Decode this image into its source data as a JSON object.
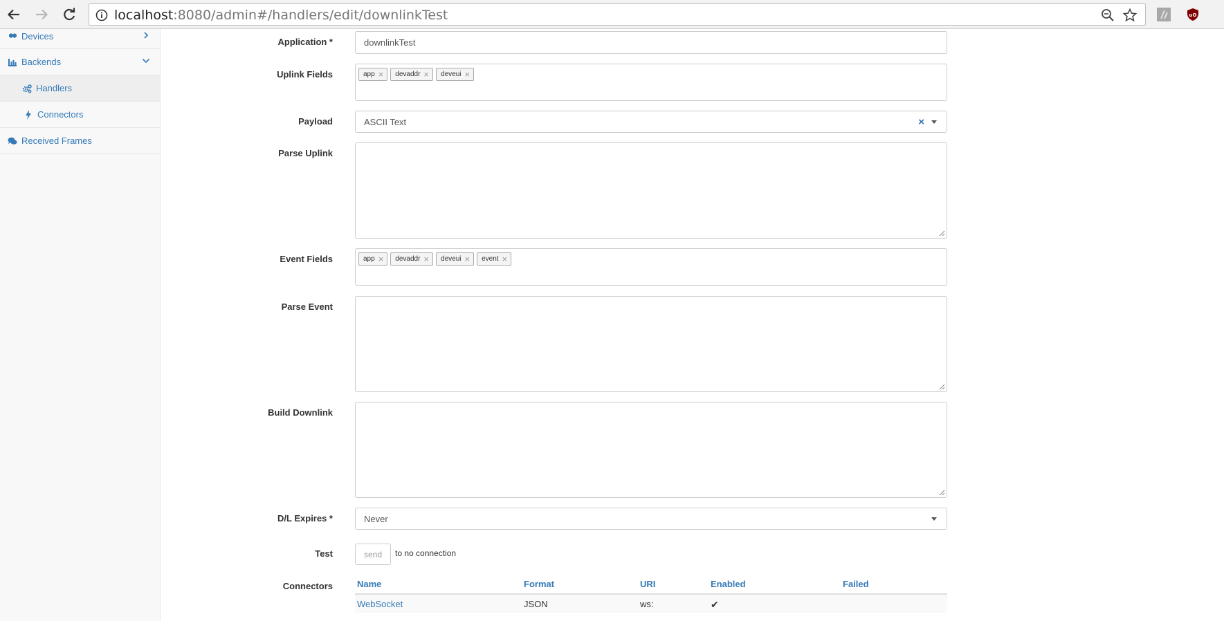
{
  "browser": {
    "url_host": "localhost",
    "url_rest": ":8080/admin#/handlers/edit/downlinkTest",
    "colors": {
      "ublock": "#800000"
    }
  },
  "sidebar": {
    "items": [
      {
        "label": "Devices",
        "icon": "cubes-icon"
      },
      {
        "label": "Backends",
        "icon": "bar-chart-icon"
      },
      {
        "label": "Handlers",
        "icon": "cogs-icon",
        "active": true
      },
      {
        "label": "Connectors",
        "icon": "bolt-icon"
      },
      {
        "label": "Received Frames",
        "icon": "comments-icon"
      }
    ]
  },
  "form": {
    "application": {
      "label": "Application *",
      "value": "downlinkTest"
    },
    "uplink_fields": {
      "label": "Uplink Fields",
      "tags": [
        "app",
        "devaddr",
        "deveui"
      ]
    },
    "payload": {
      "label": "Payload",
      "value": "ASCII Text"
    },
    "parse_uplink": {
      "label": "Parse Uplink",
      "value": ""
    },
    "event_fields": {
      "label": "Event Fields",
      "tags": [
        "app",
        "devaddr",
        "deveui",
        "event"
      ]
    },
    "parse_event": {
      "label": "Parse Event",
      "value": ""
    },
    "build_downlink": {
      "label": "Build Downlink",
      "value": ""
    },
    "dl_expires": {
      "label": "D/L Expires *",
      "value": "Never"
    },
    "test": {
      "label": "Test",
      "button": "send",
      "note": "to no connection"
    },
    "connectors": {
      "label": "Connectors",
      "columns": [
        "Name",
        "Format",
        "URI",
        "Enabled",
        "Failed"
      ],
      "rows": [
        {
          "name": "WebSocket",
          "format": "JSON",
          "uri": "ws:",
          "enabled": "✔",
          "failed": ""
        }
      ]
    }
  }
}
